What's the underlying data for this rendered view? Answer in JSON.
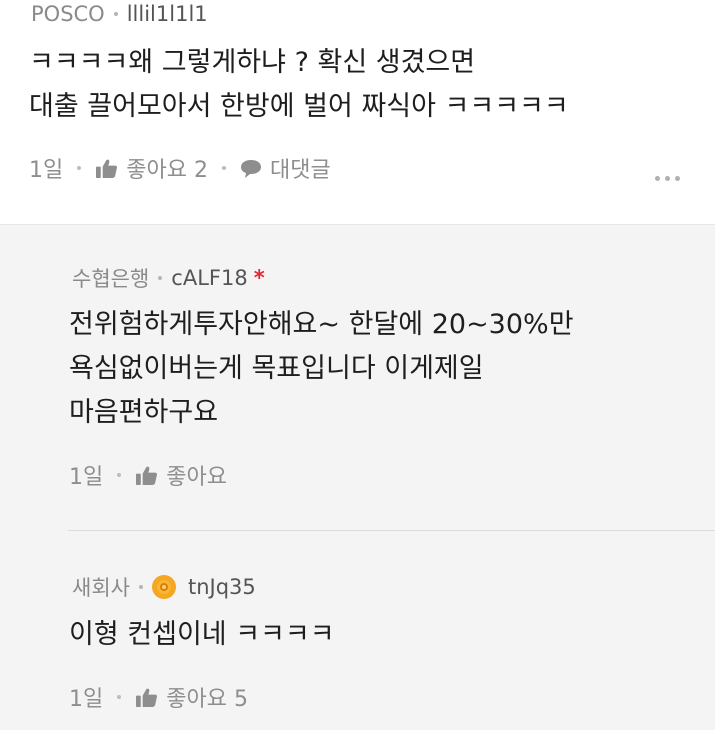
{
  "comment": {
    "company": "POSCO",
    "nickname": "lllil1l1l1",
    "lines": [
      "ㅋㅋㅋㅋ왜 그렇게하냐 ? 확신 생겼으면",
      "대출 끌어모아서 한방에 벌어 짜식아 ㅋㅋㅋㅋㅋ"
    ],
    "time": "1일",
    "like_label": "좋아요 2",
    "reply_label": "대댓글"
  },
  "replies": [
    {
      "company": "수협은행",
      "nickname": "cALF18",
      "author_mark": "*",
      "lines": [
        "전위험하게투자안해요~ 한달에 20~30%만",
        "욕심없이버는게 목표입니다 이게제일",
        "마음편하구요"
      ],
      "time": "1일",
      "like_label": "좋아요"
    },
    {
      "company": "새회사",
      "nickname": "tnJq35",
      "lines": [
        "이형 컨셉이네 ㅋㅋㅋㅋ"
      ],
      "time": "1일",
      "like_label": "좋아요 5"
    }
  ],
  "colors": {
    "reply_background": "#f4f4f4",
    "author_mark": "#e0262f",
    "badge": "#f5a623"
  },
  "icons": {
    "like": "thumbs-up-icon",
    "reply": "speech-bubble-icon",
    "more": "more-dots-icon",
    "badge": "gold-badge-icon"
  }
}
